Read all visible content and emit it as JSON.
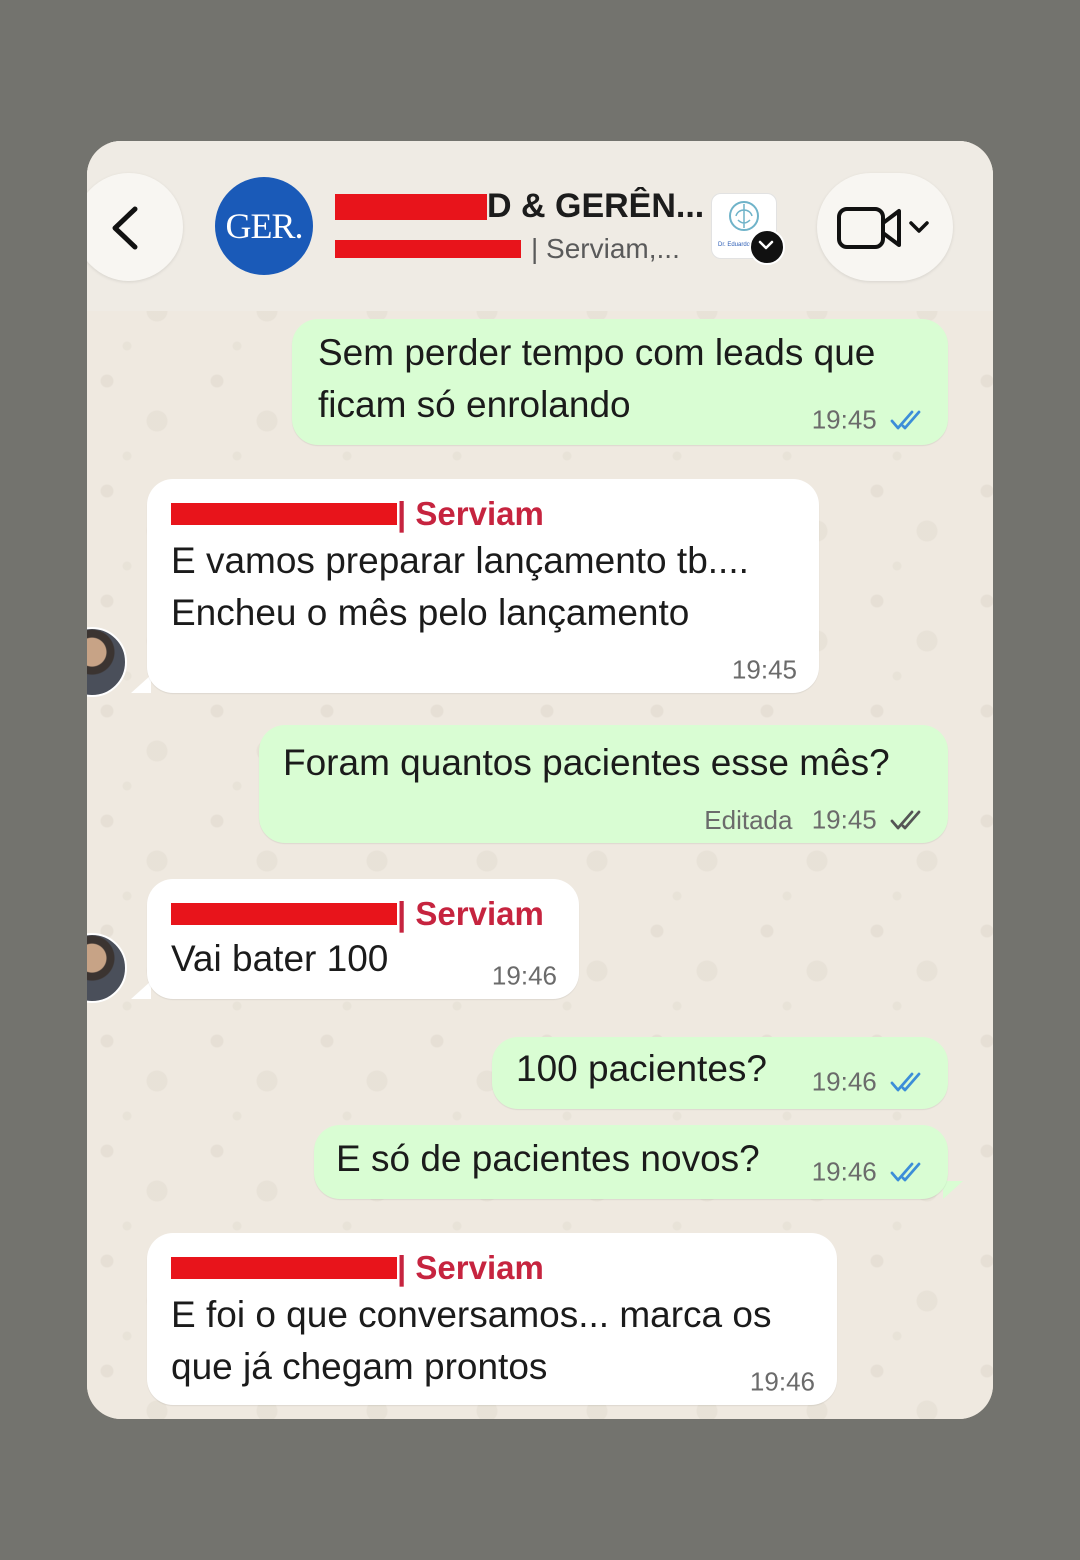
{
  "header": {
    "back_icon": "chevron-left-icon",
    "group_avatar_text": "GER.",
    "title_visible": "D & GERÊN...",
    "subtitle_visible": "| Serviam,...",
    "video_icon": "video-camera-icon",
    "dropdown_icon": "chevron-down-icon",
    "logo_caption": "Dr. Eduardo"
  },
  "colors": {
    "outgoing_bubble": "#d9fdd3",
    "incoming_bubble": "#ffffff",
    "sender_name": "#c6243f",
    "read_check": "#3c8ed8",
    "redaction": "#e8141b",
    "avatar": "#1a5ab8"
  },
  "messages": [
    {
      "direction": "out",
      "lines": [
        "Sem perder tempo com leads que",
        "ficam só enrolando"
      ],
      "time": "19:45",
      "status": "read"
    },
    {
      "direction": "in",
      "sender": "| Serviam",
      "lines": [
        "E vamos preparar lançamento tb....",
        "Encheu o mês pelo lançamento"
      ],
      "time": "19:45"
    },
    {
      "direction": "out",
      "lines": [
        "Foram quantos pacientes esse mês?"
      ],
      "edited_label": "Editada",
      "time": "19:45",
      "status": "delivered"
    },
    {
      "direction": "in",
      "sender": "| Serviam",
      "lines": [
        "Vai bater 100"
      ],
      "time": "19:46"
    },
    {
      "direction": "out",
      "lines": [
        "100 pacientes?"
      ],
      "time": "19:46",
      "status": "read"
    },
    {
      "direction": "out",
      "lines": [
        "E só de pacientes novos?"
      ],
      "time": "19:46",
      "status": "read"
    },
    {
      "direction": "in",
      "sender": "| Serviam",
      "lines": [
        "E foi o que conversamos... marca os",
        "que já chegam prontos"
      ],
      "time": "19:46"
    }
  ]
}
